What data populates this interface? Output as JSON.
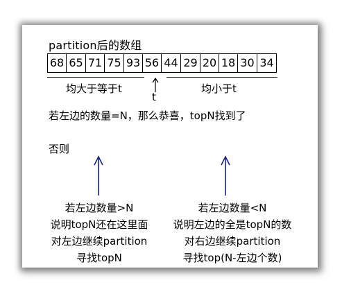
{
  "title": "partition后的数组",
  "array": [
    "68",
    "65",
    "71",
    "75",
    "93",
    "56",
    "44",
    "29",
    "20",
    "18",
    "30",
    "34"
  ],
  "labels": {
    "left_group": "均大于等于t",
    "pivot": "t",
    "right_group": "均小于t"
  },
  "statement": "若左边的数量=N，那么恭喜，topN找到了",
  "otherwise": "否则",
  "left_case": [
    "若左边数量>N",
    "说明topN还在这里面",
    "对左边继续partition",
    "寻找topN"
  ],
  "right_case": [
    "若左边数量<N",
    "说明左边的全是topN的数",
    "对右边继续partition",
    "寻找top(N-左边个数)"
  ],
  "colors": {
    "arrow": "#1a237e",
    "underline": "#1a237e",
    "text": "#000000"
  }
}
